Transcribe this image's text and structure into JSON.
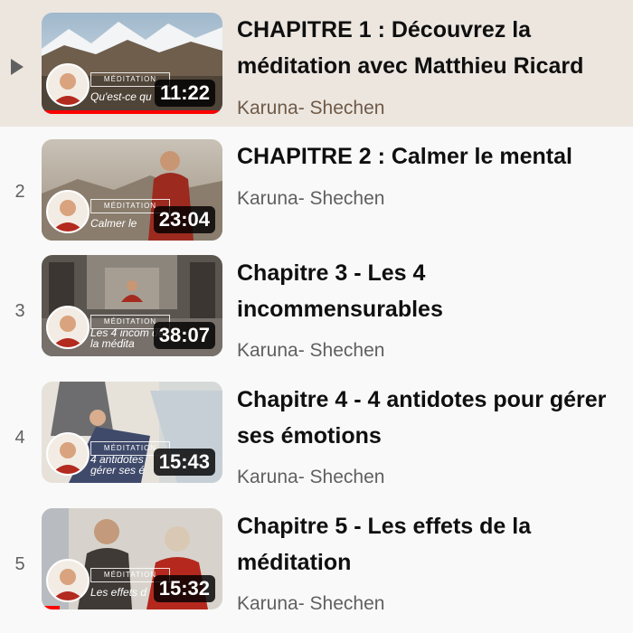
{
  "playlist": {
    "items": [
      {
        "index": "",
        "title": "CHAPITRE 1 : Découvrez la méditation avec Matthieu Ricard",
        "channel": "Karuna- Shechen",
        "duration": "11:22",
        "tag": "MÉDITATION",
        "subtitle": "Qu'est-ce qu",
        "watched_fraction": 1.0,
        "playing": true
      },
      {
        "index": "2",
        "title": "CHAPITRE 2 : Calmer le mental",
        "channel": "Karuna- Shechen",
        "duration": "23:04",
        "tag": "MÉDITATION",
        "subtitle": "Calmer le",
        "watched_fraction": 0,
        "playing": false
      },
      {
        "index": "3",
        "title": "Chapitre 3 - Les 4 incommensurables",
        "channel": "Karuna- Shechen",
        "duration": "38:07",
        "tag": "MÉDITATION",
        "subtitle": "Les 4 incom de la médita",
        "watched_fraction": 0,
        "playing": false
      },
      {
        "index": "4",
        "title": "Chapitre 4 - 4 antidotes pour gérer ses émotions",
        "channel": "Karuna- Shechen",
        "duration": "15:43",
        "tag": "MÉDITATION",
        "subtitle": "4 antidotes gérer ses é",
        "watched_fraction": 0,
        "playing": false
      },
      {
        "index": "5",
        "title": "Chapitre 5 - Les effets de la méditation",
        "channel": "Karuna- Shechen",
        "duration": "15:32",
        "tag": "MÉDITATION",
        "subtitle": "Les effets d",
        "watched_fraction": 0.1,
        "playing": false
      }
    ]
  },
  "colors": {
    "active_row_background": "#ece6df",
    "progress_bar": "#ff0000",
    "title_text": "#0f0f0f",
    "channel_text": "#606060"
  },
  "icons": {
    "now_playing": "play-triangle-icon"
  }
}
